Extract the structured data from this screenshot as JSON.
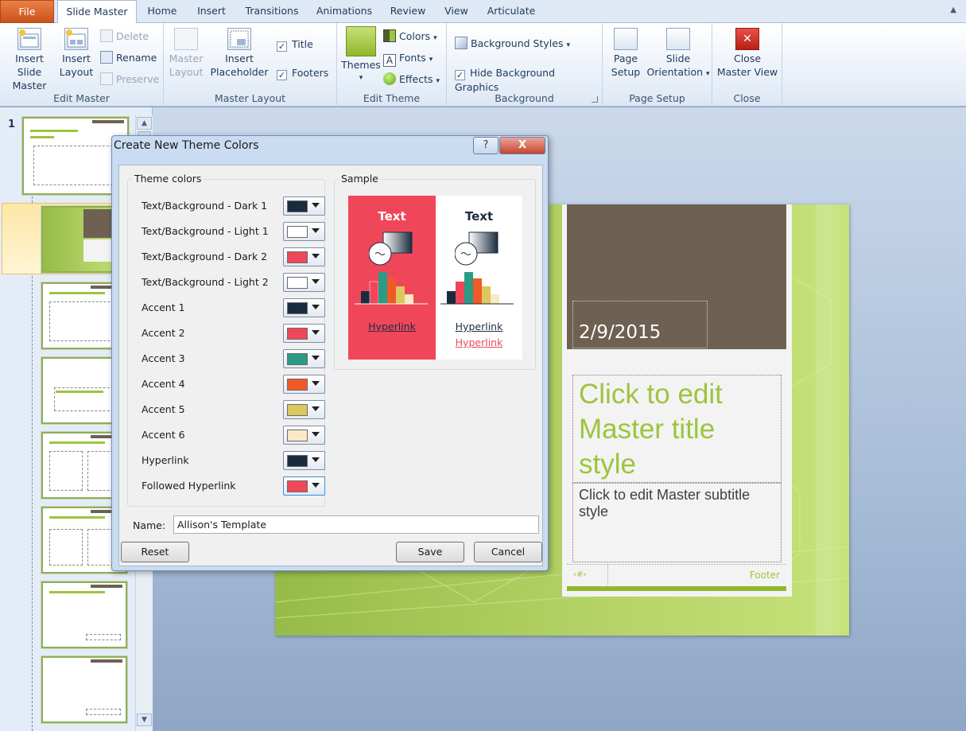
{
  "tabs": {
    "file": "File",
    "slide_master": "Slide Master",
    "home": "Home",
    "insert": "Insert",
    "transitions": "Transitions",
    "animations": "Animations",
    "review": "Review",
    "view": "View",
    "articulate": "Articulate"
  },
  "ribbon": {
    "edit_master": {
      "insert_slide_master_1": "Insert Slide",
      "insert_slide_master_2": "Master",
      "insert_layout_1": "Insert",
      "insert_layout_2": "Layout",
      "delete": "Delete",
      "rename": "Rename",
      "preserve": "Preserve",
      "label": "Edit Master"
    },
    "master_layout": {
      "master_layout_1": "Master",
      "master_layout_2": "Layout",
      "insert_placeholder_1": "Insert",
      "insert_placeholder_2": "Placeholder",
      "title": "Title",
      "footers": "Footers",
      "label": "Master Layout"
    },
    "edit_theme": {
      "themes": "Themes",
      "colors": "Colors",
      "fonts": "Fonts",
      "effects": "Effects",
      "label": "Edit Theme"
    },
    "background": {
      "background_styles": "Background Styles",
      "hide_background_graphics": "Hide Background Graphics",
      "label": "Background"
    },
    "page_setup": {
      "page_setup_1": "Page",
      "page_setup_2": "Setup",
      "slide_orientation_1": "Slide",
      "slide_orientation_2": "Orientation",
      "label": "Page Setup"
    },
    "close": {
      "close_1": "Close",
      "close_2": "Master View",
      "label": "Close"
    }
  },
  "thumbnails": {
    "slide_number": "1"
  },
  "slide": {
    "date": "2/9/2015",
    "title_1": "Click to edit",
    "title_2": "Master title",
    "title_3": "style",
    "subtitle_1": "Click to edit Master subtitle",
    "subtitle_2": "style",
    "page_number": "‹#›",
    "footer": "Footer"
  },
  "dialog": {
    "title": "Create New Theme Colors",
    "help": "?",
    "close": "X",
    "theme_colors_label": "Theme colors",
    "sample_label": "Sample",
    "colors": [
      {
        "label": "Text/Background - Dark 1",
        "color": "#1b2b3e"
      },
      {
        "label": "Text/Background - Light 1",
        "color": "#ffffff"
      },
      {
        "label": "Text/Background - Dark 2",
        "color": "#ef4759"
      },
      {
        "label": "Text/Background - Light 2",
        "color": "#ffffff"
      },
      {
        "label": "Accent 1",
        "color": "#1b2b3e"
      },
      {
        "label": "Accent 2",
        "color": "#ef4759"
      },
      {
        "label": "Accent 3",
        "color": "#2a9b85"
      },
      {
        "label": "Accent 4",
        "color": "#ef5a26"
      },
      {
        "label": "Accent 5",
        "color": "#dbc85e"
      },
      {
        "label": "Accent 6",
        "color": "#fae9c5"
      },
      {
        "label": "Hyperlink",
        "color": "#1b2b3e"
      },
      {
        "label": "Followed Hyperlink",
        "color": "#ef4759"
      }
    ],
    "sample": {
      "text_dark": "Text",
      "text_light": "Text",
      "hyperlink_dark": "Hyperlink",
      "hyperlink_light": "Hyperlink",
      "followed_light": "Hyperlink"
    },
    "name_label": "Name:",
    "name_value": "Allison's Template",
    "reset": "Reset",
    "save": "Save",
    "cancel": "Cancel"
  }
}
